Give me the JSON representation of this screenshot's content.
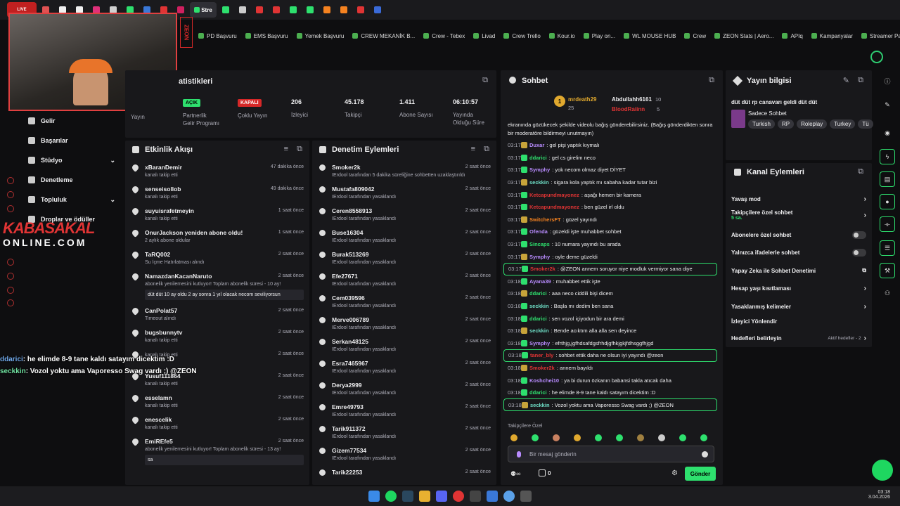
{
  "browser": {
    "active_tab": "Stre",
    "tab_colors": [
      "#e05252",
      "#f0f0f0",
      "#f0f0f0",
      "#e0307a",
      "#d0d0d0",
      "#2ee06e",
      "#3a78d8",
      "#e03434",
      "#d02060",
      "#2ee06e",
      "#cccccc",
      "#e03434",
      "#e03434",
      "#2ee06e",
      "#2ee06e",
      "#f58220",
      "#f58220",
      "#e03434",
      "#3a6ad8"
    ]
  },
  "bookmarks": [
    "PD Başvuru",
    "EMS Başvuru",
    "Yemek Başvuru",
    "CREW MEKANİK B...",
    "Crew - Tebex",
    "Livad",
    "Crew Trello",
    "Kour.io",
    "Play on...",
    "WL MOUSE HUB",
    "Crew",
    "ZEON Stats | Aero...",
    "APIq",
    "Kampanyalar",
    "Streamer Panel"
  ],
  "webcam": {
    "brand": "ZEON"
  },
  "stats": {
    "title": "atistikleri",
    "cols": [
      {
        "badge": "AÇIK",
        "label": "Partnerlik\nGelir Programı"
      },
      {
        "badge": "KAPALI",
        "label": "Çoklu Yayın"
      },
      {
        "value": "206",
        "label": "İzleyici"
      },
      {
        "value": "45.178",
        "label": "Takipçi"
      },
      {
        "value": "1.411",
        "label": "Abone Sayısı"
      },
      {
        "value": "06:10:57",
        "label": "Yayında\nOlduğu Süre"
      }
    ],
    "yayin": "Yayın"
  },
  "nav": [
    "Gelir",
    "Başarılar",
    "Stüdyo",
    "Denetleme",
    "Topluluk",
    "Droplar ve ödüller"
  ],
  "logo": {
    "line1": "KABASAKAL",
    "line2": "ONLINE.COM"
  },
  "overlay_chat": [
    {
      "user": "ddarici",
      "text": ": he elimde 8-9 tane kaldı satayım dicektim :D"
    },
    {
      "user": "seckkin",
      "text": ": Vozol yoktu ama Vaporesso Swag vardı ;) @ZEON"
    }
  ],
  "activity": {
    "title": "Etkinlik Akışı",
    "rows": [
      {
        "name": "xBaranDemir",
        "sub": "kanalı takip etti",
        "time": "47 dakika önce"
      },
      {
        "name": "senseisollob",
        "sub": "kanalı takip etti",
        "time": "49 dakika önce"
      },
      {
        "name": "suyuisrafetmeyin",
        "sub": "kanalı takip etti",
        "time": "1 saat önce"
      },
      {
        "name": "OnurJackson yeniden abone oldu!",
        "sub": "2 aylık abone oldular",
        "time": "1 saat önce"
      },
      {
        "name": "TaRQ002",
        "sub": "Su İçme Hatırlatması alındı",
        "time": "2 saat önce"
      },
      {
        "name": "NamazdanKacanNaruto",
        "sub": "abonelik yenilemesini kutluyor! Toplam abonelik süresi - 10 ay!",
        "time": "2 saat önce",
        "msg": "düt düt 10 ay oldu 2 ay sonra 1 yıl olacak necom seviliyorsun"
      },
      {
        "name": "CanPolat57",
        "sub": "Timeout alındı",
        "time": "2 saat önce"
      },
      {
        "name": "bugsbunnytv",
        "sub": "kanalı takip etti",
        "time": "2 saat önce"
      },
      {
        "name": "",
        "sub": "kanalı takip etti",
        "time": "2 saat önce"
      },
      {
        "name": "Yusuf111864",
        "sub": "kanalı takip etti",
        "time": "2 saat önce"
      },
      {
        "name": "esselamn",
        "sub": "kanalı takip etti",
        "time": "2 saat önce"
      },
      {
        "name": "enescelik",
        "sub": "kanalı takip etti",
        "time": "2 saat önce"
      },
      {
        "name": "EmiREfe5",
        "sub": "abonelik yenilemesini kutluyor! Toplam abonelik süresi - 13 ay!",
        "time": "2 saat önce",
        "msg": "sa"
      }
    ]
  },
  "moderation": {
    "title": "Denetim Eylemleri",
    "rows": [
      {
        "name": "Smoker2k",
        "sub": "IErdool tarafından 5 dakika süreliğine sohbetten uzaklaştırıldı",
        "time": "2 saat önce"
      },
      {
        "name": "Mustafa809042",
        "sub": "IErdool tarafından yasaklandı",
        "time": "2 saat önce"
      },
      {
        "name": "Ceren8558913",
        "sub": "IErdool tarafından yasaklandı",
        "time": "2 saat önce"
      },
      {
        "name": "Buse16304",
        "sub": "IErdool tarafından yasaklandı",
        "time": "2 saat önce"
      },
      {
        "name": "Burak513269",
        "sub": "IErdool tarafından yasaklandı",
        "time": "2 saat önce"
      },
      {
        "name": "Efe27671",
        "sub": "IErdool tarafından yasaklandı",
        "time": "2 saat önce"
      },
      {
        "name": "Cem039596",
        "sub": "IErdool tarafından yasaklandı",
        "time": "2 saat önce"
      },
      {
        "name": "Merve006789",
        "sub": "IErdool tarafından yasaklandı",
        "time": "2 saat önce"
      },
      {
        "name": "Serkan48125",
        "sub": "IErdool tarafından yasaklandı",
        "time": "2 saat önce"
      },
      {
        "name": "Esra7465967",
        "sub": "IErdool tarafından yasaklandı",
        "time": "2 saat önce"
      },
      {
        "name": "Derya2999",
        "sub": "IErdool tarafından yasaklandı",
        "time": "2 saat önce"
      },
      {
        "name": "Emre49793",
        "sub": "IErdool tarafından yasaklandı",
        "time": "2 saat önce"
      },
      {
        "name": "Tarik911372",
        "sub": "IErdool tarafından yasaklandı",
        "time": "2 saat önce"
      },
      {
        "name": "Gizem77534",
        "sub": "IErdool tarafından yasaklandı",
        "time": "2 saat önce"
      },
      {
        "name": "Tarik22253",
        "sub": "",
        "time": "2 saat önce"
      }
    ]
  },
  "chat": {
    "title": "Sohbet",
    "top": [
      {
        "name": "mrdeath29",
        "count": "25"
      },
      {
        "name": "Abdullahh6161",
        "count": "10"
      },
      {
        "name": "BloodRaiinn",
        "count": "5"
      }
    ],
    "intro": "ekranında gözükecek şekilde videolu bağış gönderebilirsiniz. (Bağış gönderdikten sonra bir moderatöre bildirmeyi unutmayın)",
    "lines": [
      {
        "t": "03:17",
        "u": "Duxar",
        "c": "#b98cff",
        "m": ": gel pişi yaptık kıymalı"
      },
      {
        "t": "03:17",
        "u": "ddarici",
        "c": "#2ee06e",
        "m": ": gel cs girelim neco"
      },
      {
        "t": "03:17",
        "u": "Symphy",
        "c": "#b98cff",
        "m": ": yok necom olmaz diyet DİYET"
      },
      {
        "t": "03:17",
        "u": "seckkin",
        "c": "#6fe0c8",
        "m": ": sigara kola yaptık mı sabaha kadar tutar bizi"
      },
      {
        "t": "03:17",
        "u": "Ketcapundmayonez",
        "c": "#e03434",
        "m": ": aşağı hemen bir kamera"
      },
      {
        "t": "03:17",
        "u": "Ketcapundmayonez",
        "c": "#e03434",
        "m": ": ben güzel irl oldu"
      },
      {
        "t": "03:17",
        "u": "SwitchersFT",
        "c": "#f58220",
        "m": ": güzel yayındı"
      },
      {
        "t": "03:17",
        "u": "Ofenda",
        "c": "#b98cff",
        "m": ": güzeldi işte muhabbet sohbet"
      },
      {
        "t": "03:17",
        "u": "Sincaps",
        "c": "#2ee06e",
        "m": ": 10 numara yayındı bu arada"
      },
      {
        "t": "03:17",
        "u": "Symphy",
        "c": "#b98cff",
        "m": ": oyle deme güzeldi"
      },
      {
        "t": "03:17",
        "u": "Smoker2k",
        "c": "#e03434",
        "m": ": @ZEON annem soruyor niye modluk vermiyor sana diye",
        "hl": true
      },
      {
        "t": "03:18",
        "u": "Ayana39",
        "c": "#b98cff",
        "m": ": muhabbet ettik işte"
      },
      {
        "t": "03:18",
        "u": "ddarici",
        "c": "#2ee06e",
        "m": ": aaa neco ciddili bişi dicem"
      },
      {
        "t": "03:18",
        "u": "seckkin",
        "c": "#6fe0c8",
        "m": ": Başla mı dedim ben sana"
      },
      {
        "t": "03:18",
        "u": "ddarici",
        "c": "#2ee06e",
        "m": ": sen vozol içiyodun bir ara demi"
      },
      {
        "t": "03:18",
        "u": "seckkin",
        "c": "#6fe0c8",
        "m": ": Bende acıktım alla alla sen deyince"
      },
      {
        "t": "03:18",
        "u": "Symphy",
        "c": "#b98cff",
        "m": ": efrthjg,jgfhdsafdgsfrhdjgfhkjgkjfdhsggfhjgd"
      },
      {
        "t": "03:18",
        "u": "taner_bly",
        "c": "#e03434",
        "m": ": sohbet ettik daha ne olsun iyi yayındı @zeon",
        "hl": true
      },
      {
        "t": "03:18",
        "u": "Smoker2k",
        "c": "#e03434",
        "m": ": annem bayıldı"
      },
      {
        "t": "03:18",
        "u": "Koshchei10",
        "c": "#b98cff",
        "m": ": ya bi durun özkanın babansi takla atıcak daha"
      },
      {
        "t": "03:18",
        "u": "ddarici",
        "c": "#2ee06e",
        "m": ": he elimde 8-9 tane kaldı satayım dicektim :D"
      },
      {
        "t": "03:18",
        "u": "seckkin",
        "c": "#6fe0c8",
        "m": ": Vozol yoktu ama Vaporesso Swag vardı ;) @ZEON",
        "hl": true
      }
    ],
    "followers_label": "Takipçilere Özel",
    "placeholder": "Bir mesaj gönderin",
    "send": "Gönder",
    "points": "0"
  },
  "stream_info": {
    "title": "Yayın bilgisi",
    "desc": "düt düt rp canavarı geldi düt düt",
    "category": "Sadece Sohbet",
    "tags": [
      "Turkish",
      "RP",
      "Roleplay",
      "Turkey",
      "Tü"
    ]
  },
  "channel_actions": {
    "title": "Kanal Eylemleri",
    "rows": [
      "Yavaş mod",
      "Takipçilere özel sohbet",
      "Abonelere özel sohbet",
      "Yalnızca ifadelerle sohbet",
      "Yapay Zeka ile Sohbet Denetimi",
      "Hesap yaşı kısıtlaması",
      "Yasaklanmış kelimeler",
      "İzleyici Yönlendir",
      "Hedefleri belirleyin"
    ],
    "followers_sub": "5 sa.",
    "goals_sub": "Aktif hedefler - 2"
  },
  "clock": {
    "time": "03:18",
    "date": "3.04.2026"
  }
}
